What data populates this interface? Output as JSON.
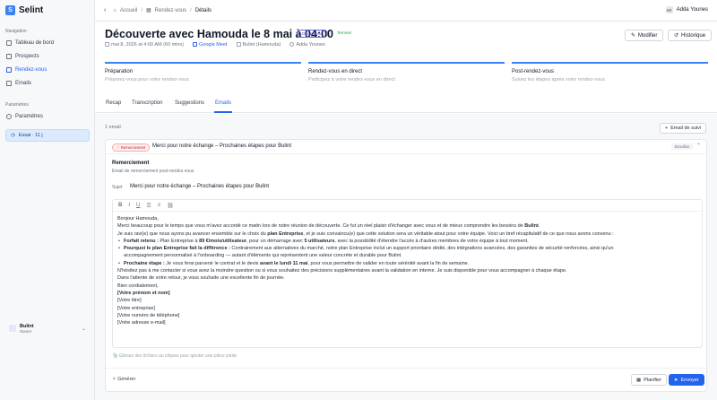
{
  "brand": {
    "name": "Selint",
    "logo": "S"
  },
  "nav": {
    "section": "Navigation",
    "items": [
      {
        "label": "Tableau de bord",
        "icon": "grid-icon"
      },
      {
        "label": "Prospects",
        "icon": "users-icon"
      },
      {
        "label": "Rendez-vous",
        "icon": "calendar-icon"
      },
      {
        "label": "Emails",
        "icon": "mail-icon"
      }
    ],
    "params_section": "Paramètres",
    "params_item": "Paramètres",
    "trial": "Essai · 11 j"
  },
  "org": {
    "name": "Bulint",
    "plan": "Owner"
  },
  "topbar": {
    "crumbs": [
      "Accueil",
      "Rendez-vous",
      "Détails"
    ],
    "user": "Adda Younes",
    "user_initials": "AY"
  },
  "header": {
    "title": "Découverte avec Hamouda le 8 mai à 04:00",
    "badge_type": "Découverte",
    "badge_status": "Terminé",
    "datetime": "mai 8, 2026 at 4:00 AM (60 mins)",
    "location": "Google Meet",
    "company": "Bulint (Hamouda)",
    "owner": "Adda Younes",
    "btn_modifier": "Modifier",
    "btn_historique": "Historique"
  },
  "phases": [
    {
      "name": "Préparation",
      "desc": "Préparez-vous pour votre rendez-vous"
    },
    {
      "name": "Rendez-vous en direct",
      "desc": "Participez à votre rendez-vous en direct"
    },
    {
      "name": "Post-rendez-vous",
      "desc": "Suivez les étapes après votre rendez-vous"
    }
  ],
  "tabs": [
    "Recap",
    "Transcription",
    "Suggestions",
    "Emails"
  ],
  "emails": {
    "count": "1 email",
    "add_button": "Email de suivi",
    "card": {
      "chip": "Remerciement",
      "subject": "Merci pour notre échange – Prochaines étapes pour Bulint",
      "status": "Brouillon",
      "template_name": "Remerciement",
      "template_desc": "Email de remerciement post-rendez-vous",
      "subject_label": "Sujet",
      "subject_value": "Merci pour notre échange – Prochaines étapes pour Bulint",
      "body": {
        "greeting": "Bonjour Hamouda,",
        "p1": "Merci beaucoup pour le temps que vous m'avez accordé ce matin lors de notre réunion de découverte. Ce fut un réel plaisir d'échanger avec vous et de mieux comprendre les besoins de ",
        "p1_bold": "Bulint",
        "p1_end": ".",
        "p2_a": "Je suis ravi(e) que nous ayons pu avancer ensemble sur le choix du ",
        "p2_b": "plan Entreprise",
        "p2_c": ", et je suis convaincu(e) que cette solution sera un véritable atout pour votre équipe. Voici un bref récapitulatif de ce que nous avons convenu :",
        "b1_label": "Forfait retenu :",
        "b1_a": " Plan Entreprise à ",
        "b1_b": "89 €/mois/utilisateur",
        "b1_c": ", pour un démarrage avec ",
        "b1_d": "5 utilisateurs",
        "b1_e": ", avec la possibilité d'étendre l'accès à d'autres membres de votre équipe à tout moment.",
        "b2_label": "Pourquoi le plan Entreprise fait la différence :",
        "b2_a": " Contrairement aux alternatives du marché, notre plan Entreprise inclut un support prioritaire dédié, des intégrations avancées, des garanties de sécurité renforcées, ainsi qu'un",
        "b2_b": "accompagnement personnalisé à l'onboarding — autant d'éléments qui représentent une valeur concrète et durable pour Bulint.",
        "b3_label": "Prochaine étape :",
        "b3_a": " Je vous ferai parvenir le contrat et le devis ",
        "b3_b": "avant le lundi 11 mai",
        "b3_c": ", pour vous permettre de valider en toute sérénité avant la fin de semaine.",
        "p3": "N'hésitez pas à me contacter si vous avez la moindre question ou si vous souhaitez des précisions supplémentaires avant la validation en interne. Je suis disponible pour vous accompagner à chaque étape.",
        "p4": "Dans l'attente de votre retour, je vous souhaite une excellente fin de journée.",
        "p5": "Bien cordialement,",
        "sig1": "[Votre prénom et nom]",
        "sig2": "[Votre titre]",
        "sig3": "[Votre entreprise]",
        "sig4": "[Votre numéro de téléphone]",
        "sig5": "[Votre adresse e-mail]"
      },
      "attach_hint": "Glissez des fichiers ou cliquez pour ajouter une pièce jointe",
      "btn_generate": "Générer",
      "btn_schedule": "Planifier",
      "btn_send": "Envoyer"
    }
  },
  "colors": {
    "accent": "#2563eb",
    "success": "#16a34a",
    "badge_red": "#b91c1c"
  }
}
